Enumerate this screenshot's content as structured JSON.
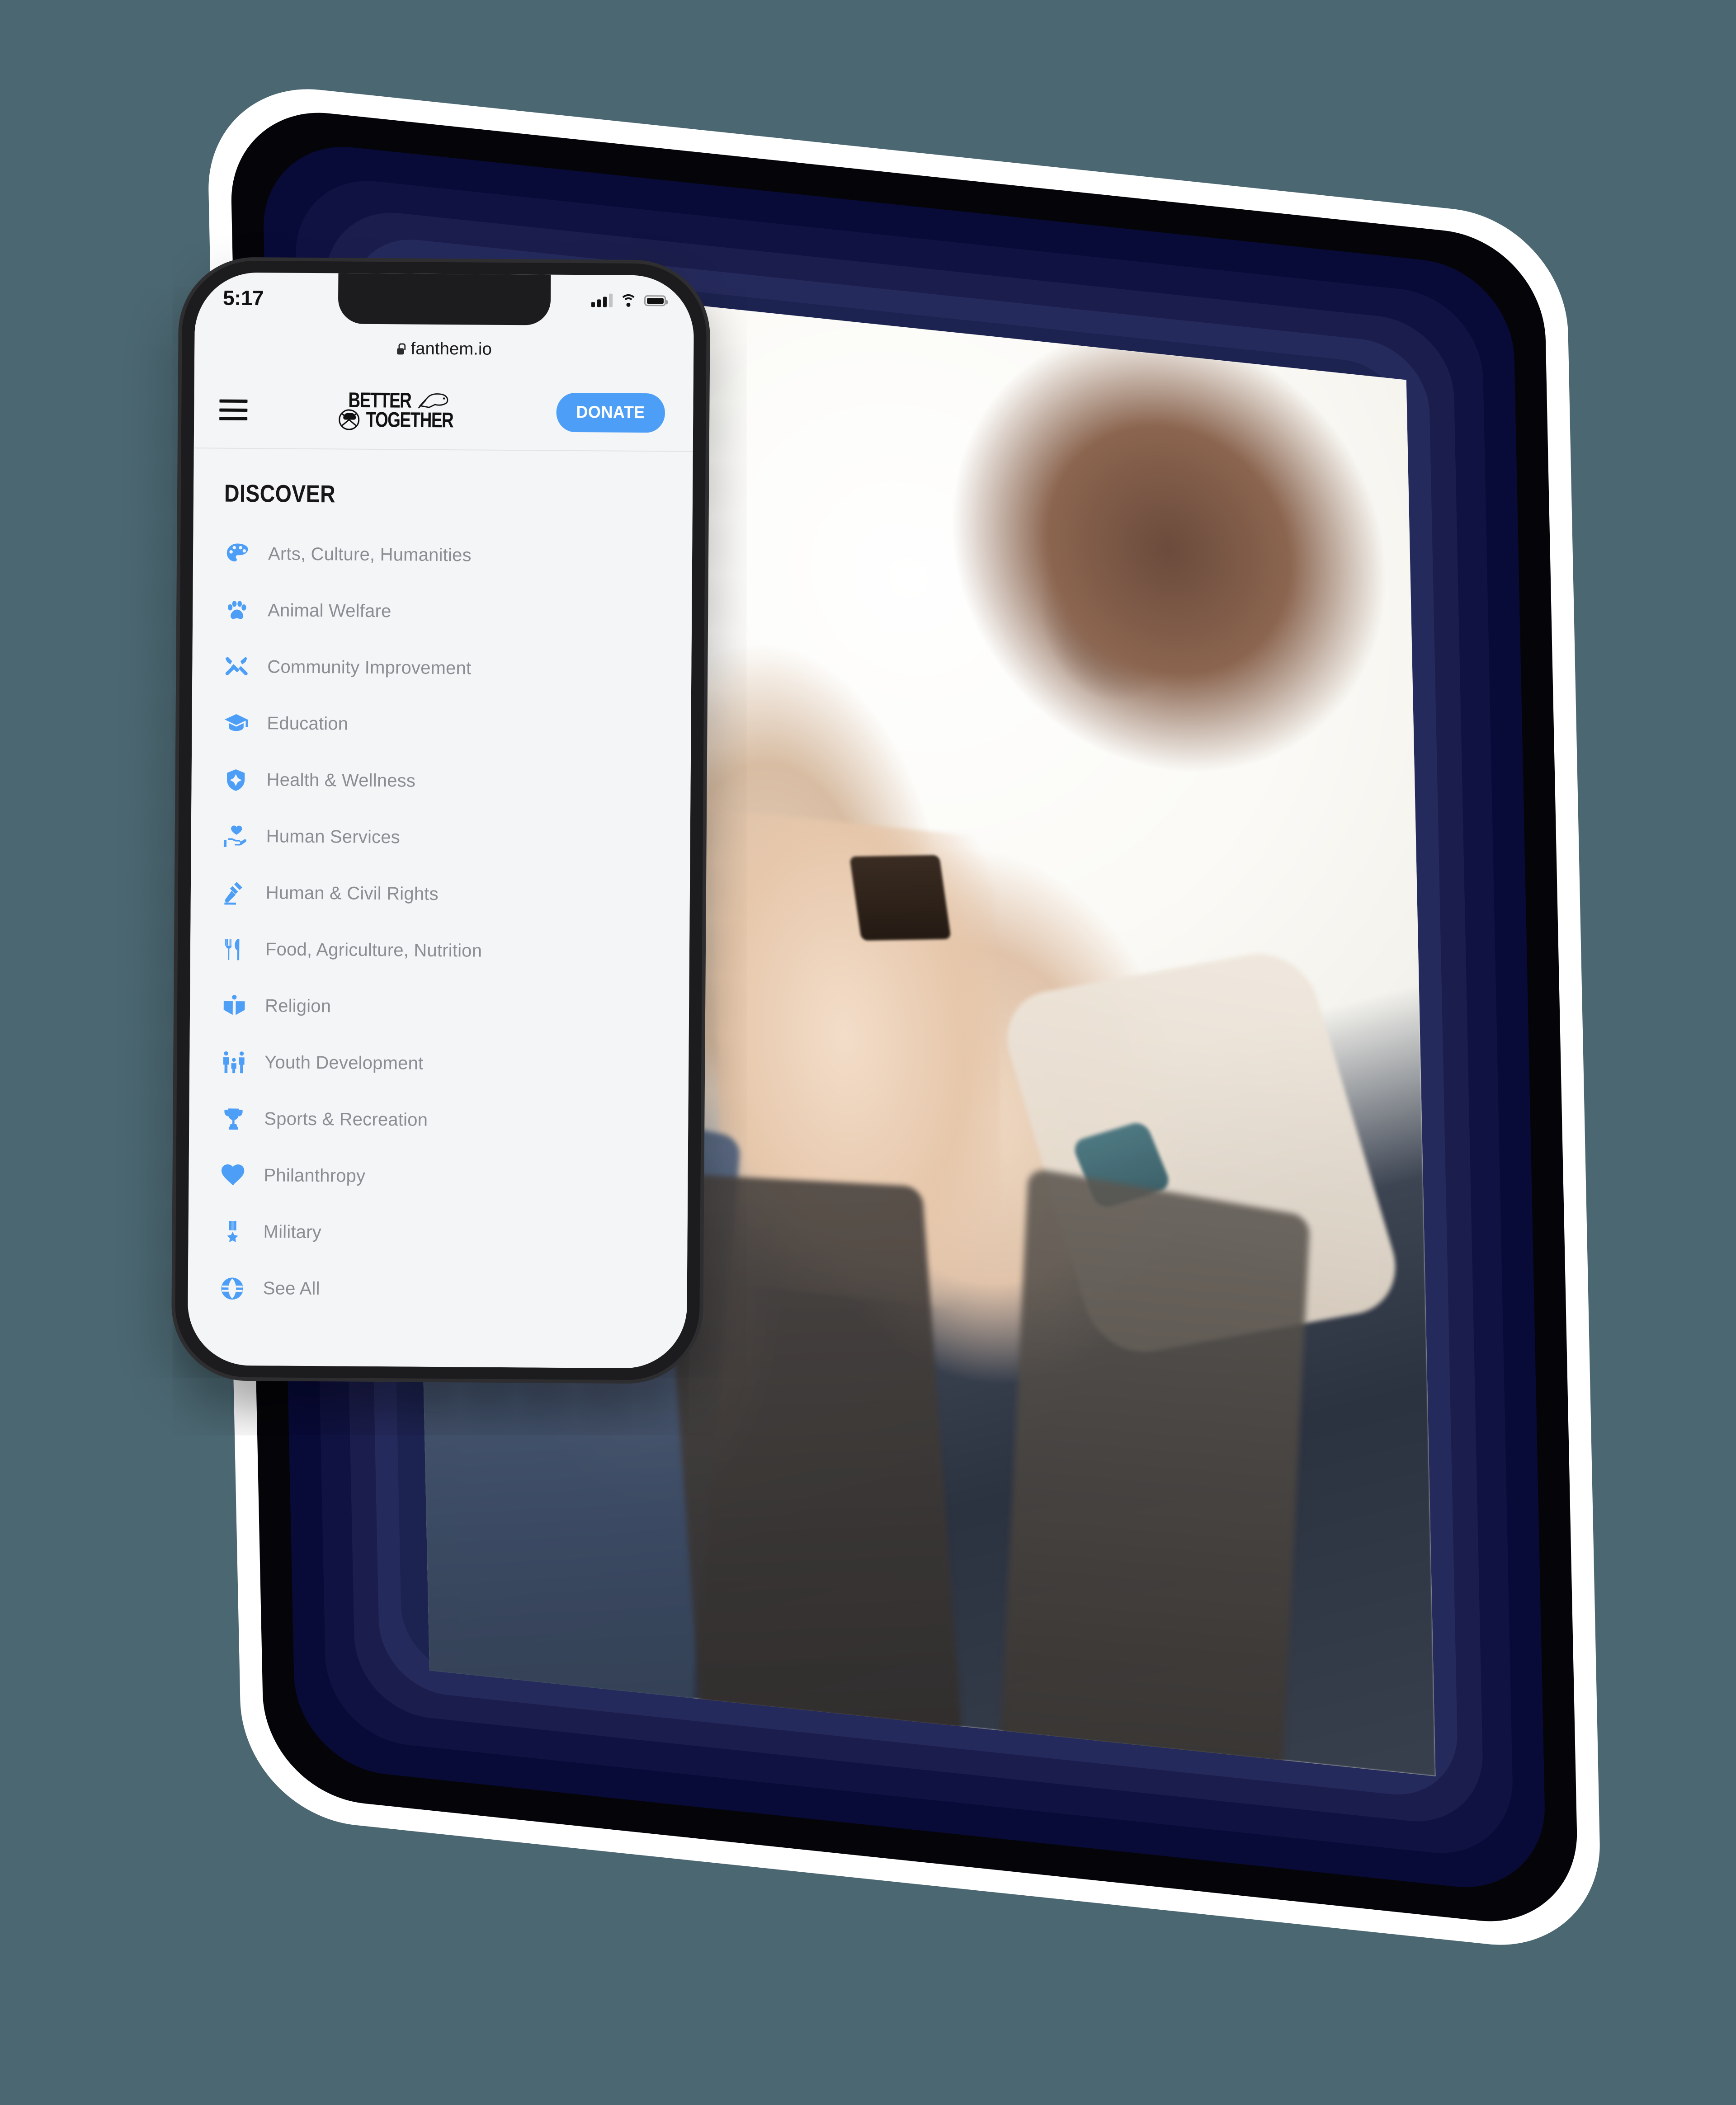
{
  "background_color": "#4b6771",
  "accent_color": "#4d9ef7",
  "device": {
    "tablet_frame_colors": [
      "#ffffff",
      "#050509",
      "#080a38",
      "#101241",
      "#1b1d4c",
      "#252a5c"
    ],
    "phone_frame_color": "#1c1c1e",
    "tablet_screen_photo_alt": "hands stacked together in a team huddle"
  },
  "statusbar": {
    "time": "5:17",
    "signal_icon": "cellular-signal-icon",
    "wifi_icon": "wifi-icon",
    "battery_icon": "battery-icon"
  },
  "browser": {
    "lock_icon": "lock-icon",
    "url": "fanthem.io"
  },
  "navbar": {
    "menu_icon": "hamburger-menu-icon",
    "logo": {
      "line1": "BETTER",
      "line2": "TOGETHER",
      "mark_icon": "buffalo-icon",
      "badge_icon": "circle-buffalo-badge-icon"
    },
    "donate_label": "DONATE"
  },
  "menu": {
    "title": "DISCOVER",
    "items": [
      {
        "label": "Arts, Culture, Humanities",
        "icon": "palette-icon"
      },
      {
        "label": "Animal Welfare",
        "icon": "paw-icon"
      },
      {
        "label": "Community Improvement",
        "icon": "tools-icon"
      },
      {
        "label": "Education",
        "icon": "graduation-cap-icon"
      },
      {
        "label": "Health & Wellness",
        "icon": "shield-medical-icon"
      },
      {
        "label": "Human Services",
        "icon": "hand-holding-heart-icon"
      },
      {
        "label": "Human & Civil Rights",
        "icon": "gavel-icon"
      },
      {
        "label": "Food, Agriculture, Nutrition",
        "icon": "fork-knife-icon"
      },
      {
        "label": "Religion",
        "icon": "open-book-icon"
      },
      {
        "label": "Youth Development",
        "icon": "family-icon"
      },
      {
        "label": "Sports & Recreation",
        "icon": "trophy-icon"
      },
      {
        "label": "Philanthropy",
        "icon": "heart-icon"
      },
      {
        "label": "Military",
        "icon": "medal-icon"
      },
      {
        "label": "See All",
        "icon": "globe-icon"
      }
    ]
  }
}
